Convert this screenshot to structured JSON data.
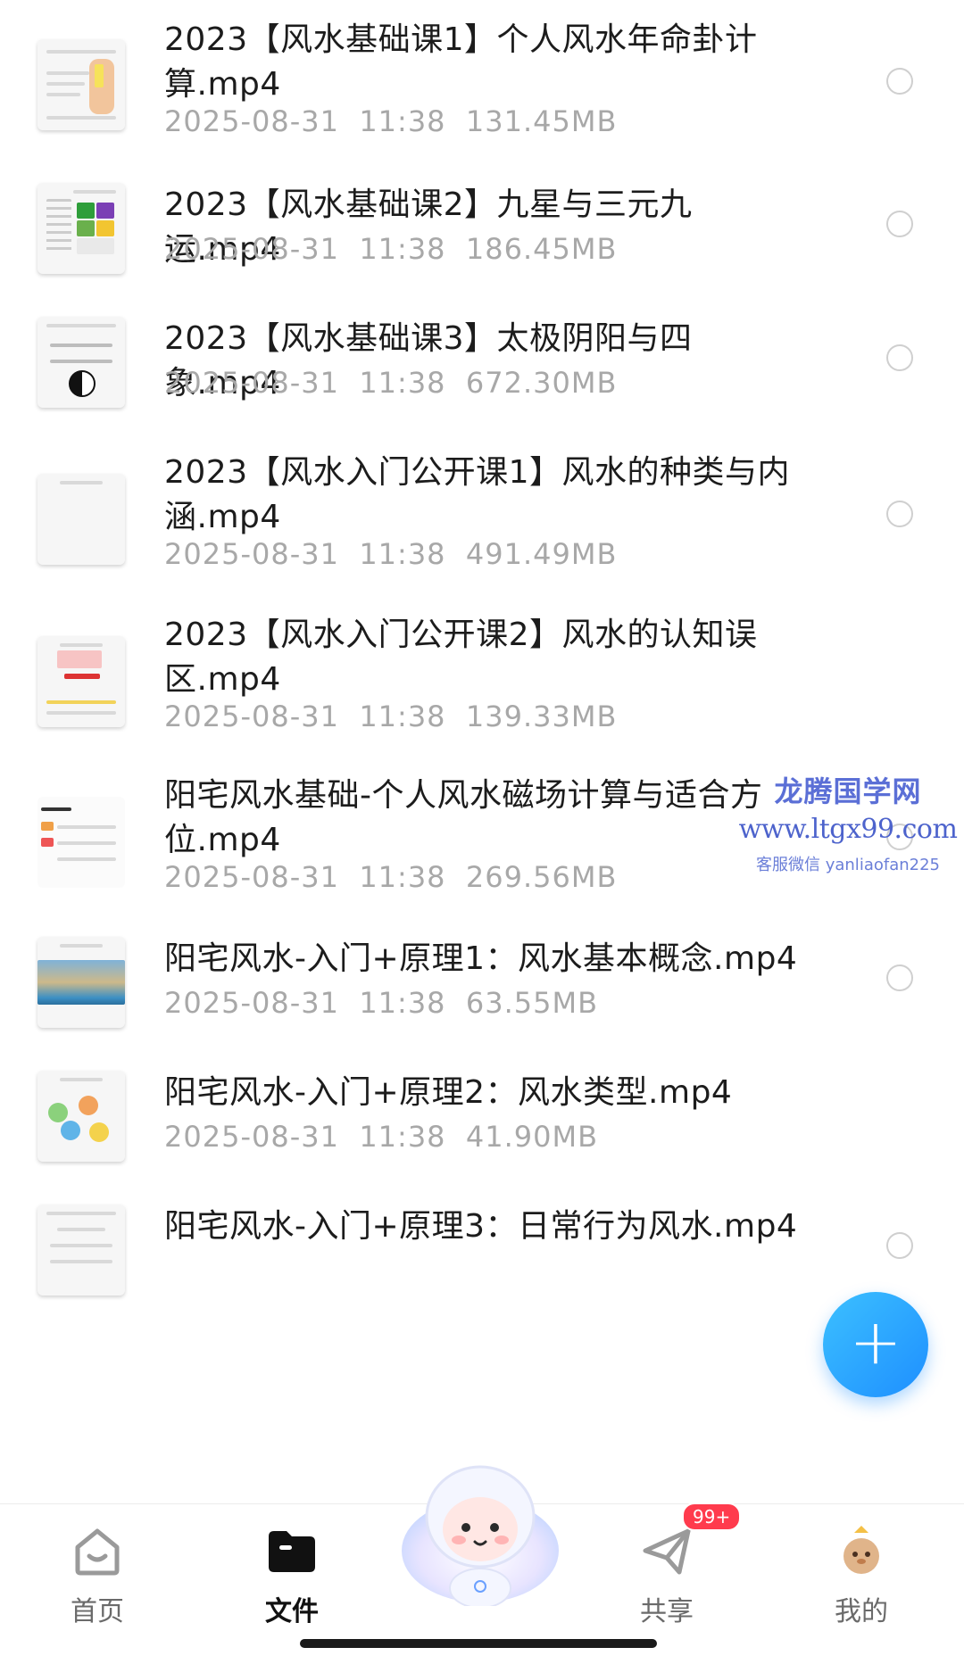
{
  "files": [
    {
      "name": "2023【风水基础课1】个人风水年命卦计算.mp4",
      "date": "2025-08-31",
      "time": "11:38",
      "size": "131.45MB"
    },
    {
      "name": "2023【风水基础课2】九星与三元九运.mp4",
      "date": "2025-08-31",
      "time": "11:38",
      "size": "186.45MB"
    },
    {
      "name": "2023【风水基础课3】太极阴阳与四象.mp4",
      "date": "2025-08-31",
      "time": "11:38",
      "size": "672.30MB"
    },
    {
      "name": "2023【风水入门公开课1】风水的种类与内涵.mp4",
      "date": "2025-08-31",
      "time": "11:38",
      "size": "491.49MB"
    },
    {
      "name": "2023【风水入门公开课2】风水的认知误区.mp4",
      "date": "2025-08-31",
      "time": "11:38",
      "size": "139.33MB"
    },
    {
      "name": "阳宅风水基础-个人风水磁场计算与适合方位.mp4",
      "date": "2025-08-31",
      "time": "11:38",
      "size": "269.56MB"
    },
    {
      "name": "阳宅风水-入门+原理1：风水基本概念.mp4",
      "date": "2025-08-31",
      "time": "11:38",
      "size": "63.55MB"
    },
    {
      "name": "阳宅风水-入门+原理2：风水类型.mp4",
      "date": "2025-08-31",
      "time": "11:38",
      "size": "41.90MB"
    },
    {
      "name": "阳宅风水-入门+原理3：日常行为风水.mp4",
      "date": "",
      "time": "",
      "size": ""
    }
  ],
  "watermark": {
    "line1": "龙腾国学网",
    "line2": "www.ltgx99.com",
    "line3": "客服微信 yanliaofan225"
  },
  "nav": {
    "items": [
      {
        "label": "首页",
        "icon": "home-icon"
      },
      {
        "label": "文件",
        "icon": "folder-icon"
      },
      {
        "label": "",
        "icon": "mascot-icon"
      },
      {
        "label": "共享",
        "icon": "share-icon"
      },
      {
        "label": "我的",
        "icon": "profile-icon"
      }
    ],
    "share_badge": "99+"
  },
  "fab": {
    "label": "+",
    "icon": "plus-icon"
  },
  "colors": {
    "accent": "#1e8fff",
    "badge": "#ff3b4d",
    "meta_text": "#a8a8a8",
    "watermark": "#5b6fd6"
  }
}
